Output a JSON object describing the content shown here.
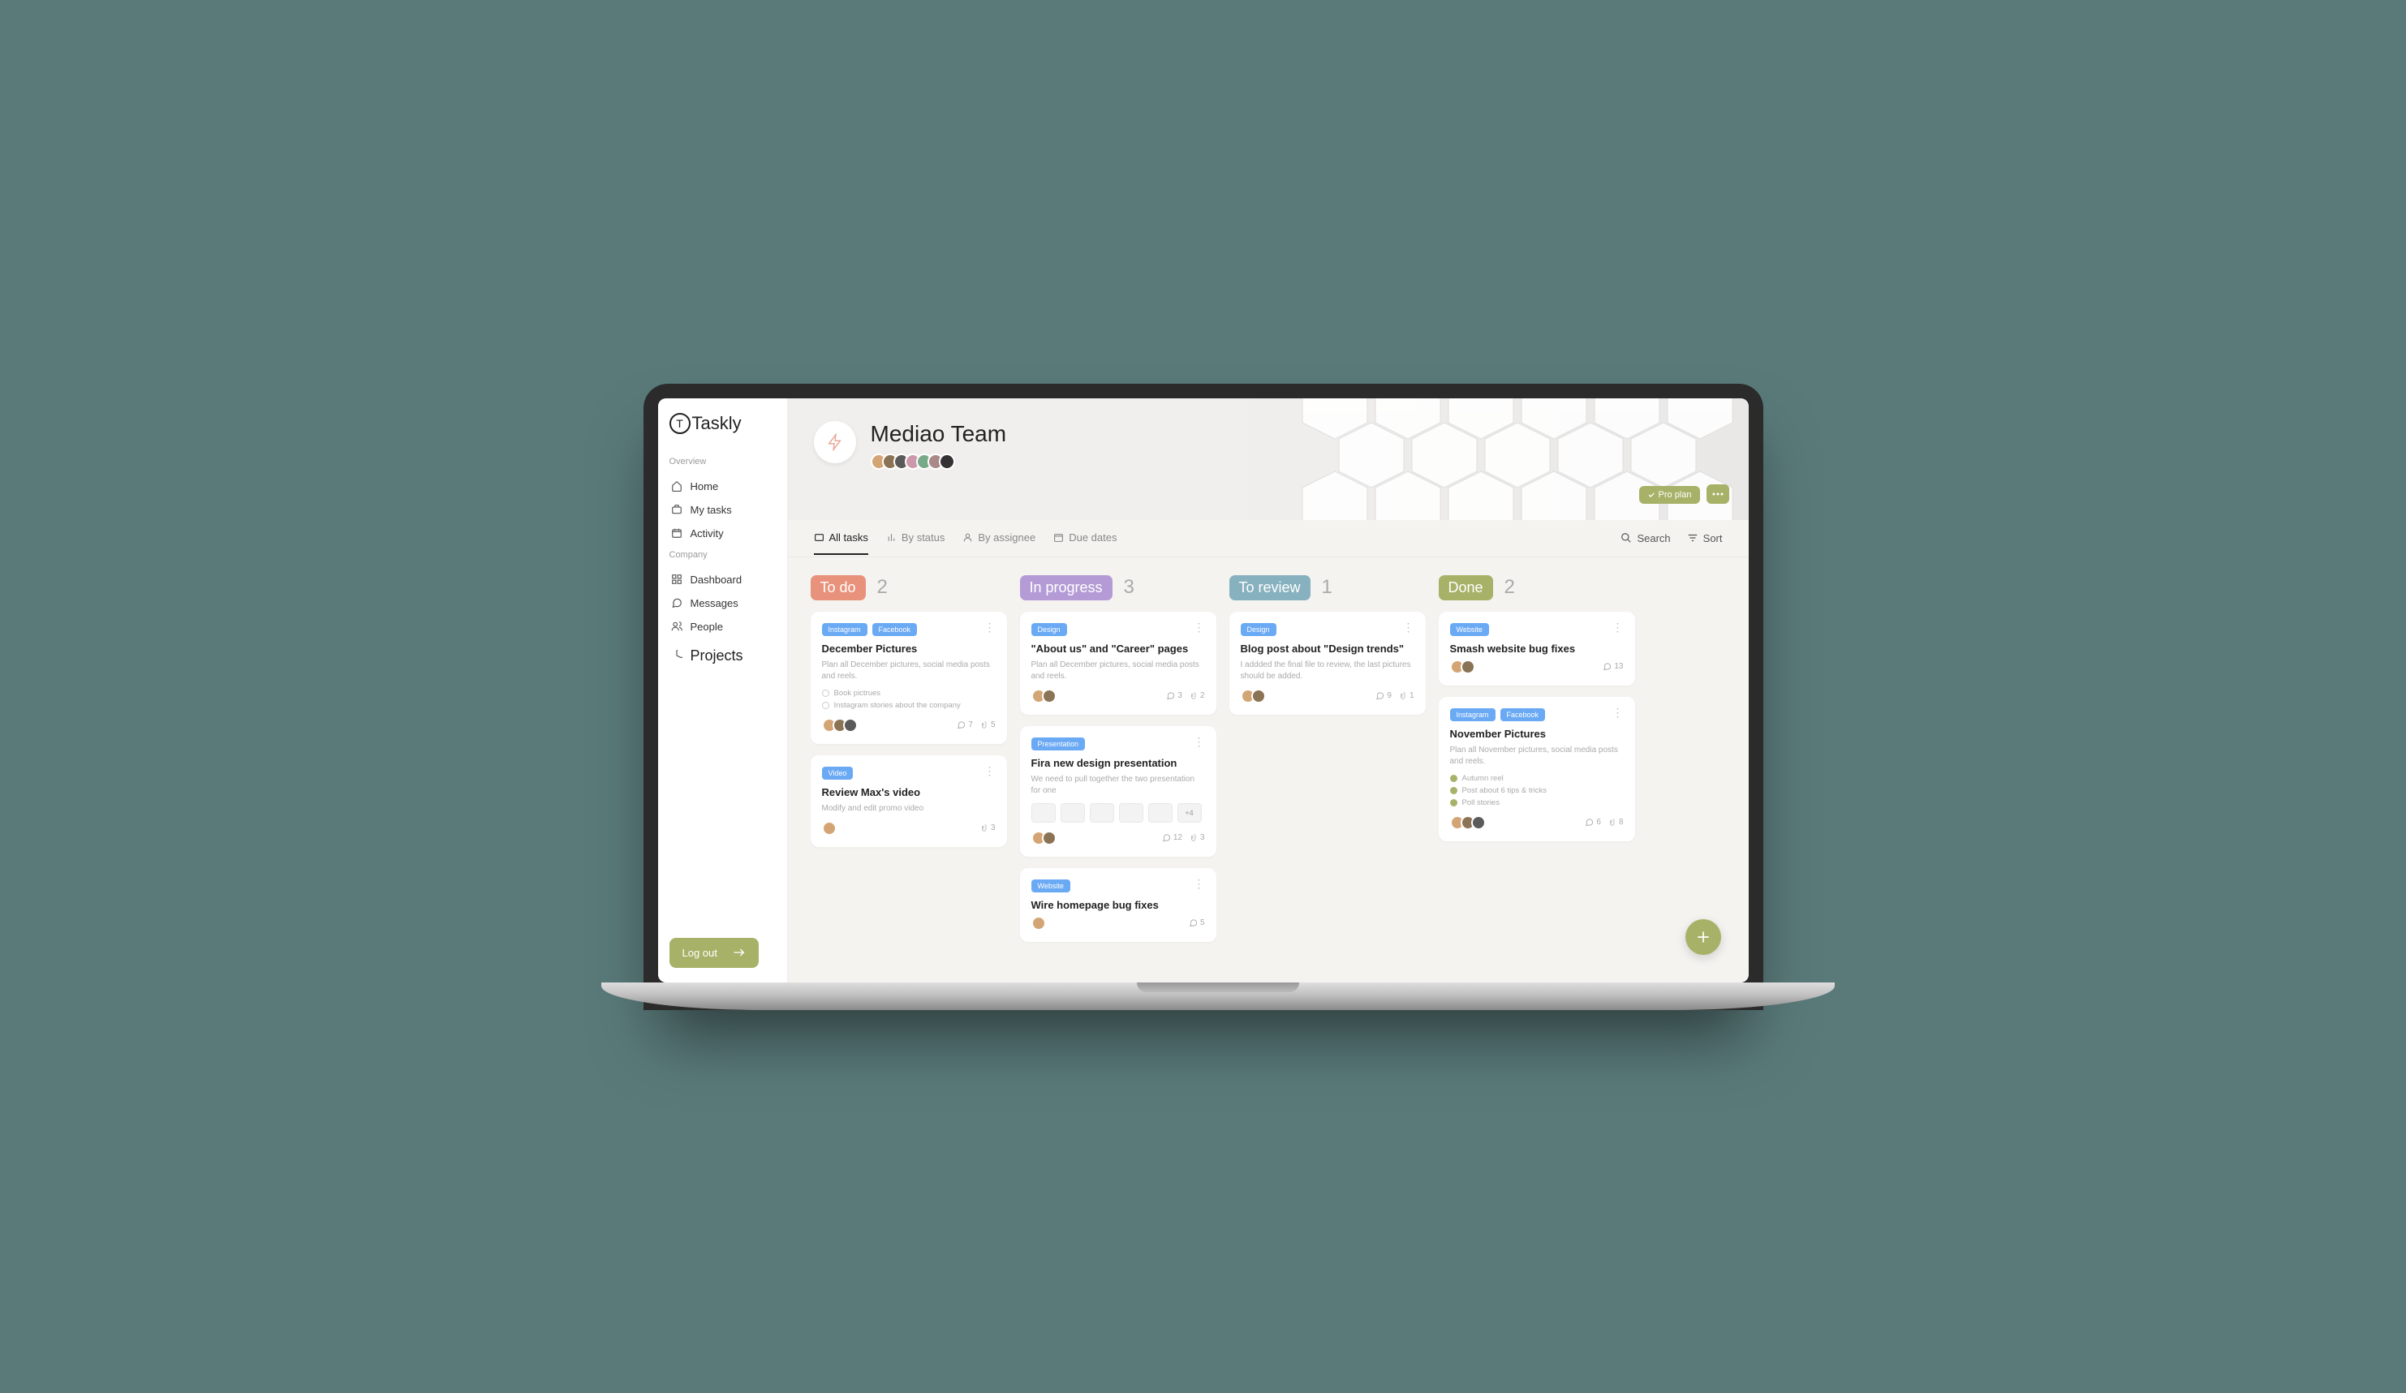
{
  "app": {
    "name": "Taskly"
  },
  "sidebar": {
    "section_overview": "Overview",
    "section_company": "Company",
    "home": "Home",
    "my_tasks": "My tasks",
    "activity": "Activity",
    "dashboard": "Dashboard",
    "messages": "Messages",
    "people": "People",
    "projects": "Projects",
    "logout": "Log out"
  },
  "header": {
    "team_name": "Mediao Team",
    "plan_badge": "Pro plan",
    "member_count": 7
  },
  "tabs": {
    "all_tasks": "All tasks",
    "by_status": "By status",
    "by_assignee": "By assignee",
    "due_dates": "Due dates",
    "search": "Search",
    "sort": "Sort"
  },
  "label_colors": {
    "Instagram": "#6aa9f4",
    "Facebook": "#6aa9f4",
    "Video": "#6aa9f4",
    "Design": "#6aa9f4",
    "Presentation": "#6aa9f4",
    "Website": "#6aa9f4"
  },
  "columns": [
    {
      "name": "To do",
      "color": "#e8927c",
      "count": 2,
      "cards": [
        {
          "labels": [
            "Instagram",
            "Facebook"
          ],
          "title": "December Pictures",
          "desc": "Plan all December pictures, social media posts and reels.",
          "checklist": [
            {
              "text": "Book pictrues",
              "done": false
            },
            {
              "text": "Instagram stories about the company",
              "done": false
            }
          ],
          "assignees": 3,
          "comments": 7,
          "attachments": 5
        },
        {
          "labels": [
            "Video"
          ],
          "title": "Review Max's video",
          "desc": "Modify and edit promo video",
          "assignees": 1,
          "attachments": 3
        }
      ]
    },
    {
      "name": "In progress",
      "color": "#b49bd6",
      "count": 3,
      "cards": [
        {
          "labels": [
            "Design"
          ],
          "title": "\"About us\" and \"Career\" pages",
          "desc": "Plan all December pictures, social media posts and reels.",
          "assignees": 2,
          "comments": 3,
          "attachments": 2
        },
        {
          "labels": [
            "Presentation"
          ],
          "title": "Fira new design presentation",
          "desc": "We need to pull together the two presentation for one",
          "thumbs": 5,
          "thumbs_more": "+4",
          "assignees": 2,
          "comments": 12,
          "attachments": 3
        },
        {
          "labels": [
            "Website"
          ],
          "title": "Wire homepage bug fixes",
          "assignees": 1,
          "comments": 5
        }
      ]
    },
    {
      "name": "To review",
      "color": "#87b1bf",
      "count": 1,
      "cards": [
        {
          "labels": [
            "Design"
          ],
          "title": "Blog post about \"Design trends\"",
          "desc": "I addded the final file to review, the last pictures should be added.",
          "assignees": 2,
          "comments": 9,
          "attachments": 1
        }
      ]
    },
    {
      "name": "Done",
      "color": "#a7b268",
      "count": 2,
      "cards": [
        {
          "labels": [
            "Website"
          ],
          "title": "Smash website bug fixes",
          "assignees": 2,
          "comments": 13
        },
        {
          "labels": [
            "Instagram",
            "Facebook"
          ],
          "title": "November Pictures",
          "desc": "Plan all November pictures, social media posts and reels.",
          "checklist": [
            {
              "text": "Autumn reel",
              "done": true
            },
            {
              "text": "Post about 6 tips & tricks",
              "done": true
            },
            {
              "text": "Poll stories",
              "done": true
            }
          ],
          "assignees": 3,
          "comments": 6,
          "attachments": 8
        }
      ]
    }
  ]
}
